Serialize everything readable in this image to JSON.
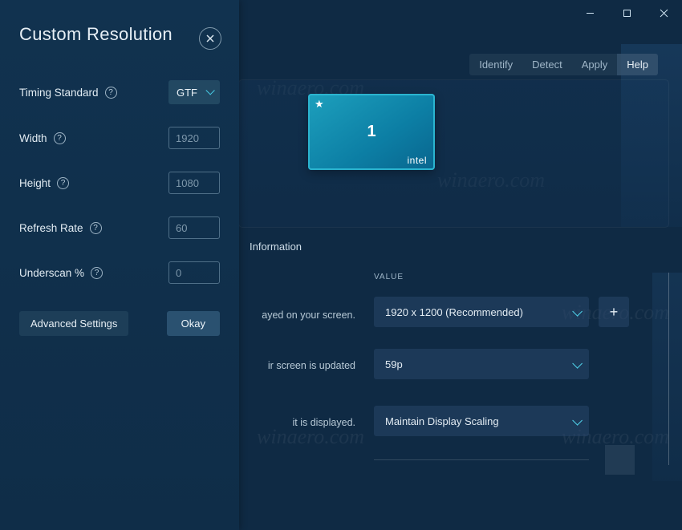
{
  "dialog": {
    "title": "Custom Resolution",
    "fields": {
      "timing_standard": {
        "label": "Timing Standard",
        "value": "GTF"
      },
      "width": {
        "label": "Width",
        "placeholder": "1920"
      },
      "height": {
        "label": "Height",
        "placeholder": "1080"
      },
      "refresh_rate": {
        "label": "Refresh Rate",
        "placeholder": "60"
      },
      "underscan": {
        "label": "Underscan %",
        "placeholder": "0"
      }
    },
    "advanced_btn": "Advanced Settings",
    "okay_btn": "Okay"
  },
  "actions": {
    "identify": "Identify",
    "detect": "Detect",
    "apply": "Apply",
    "help": "Help"
  },
  "monitor": {
    "number": "1",
    "brand": "intel",
    "star": "★"
  },
  "info": {
    "tab": "Information",
    "value_header": "VALUE",
    "rows": {
      "resolution": {
        "desc": "ayed on your screen.",
        "value": "1920 x 1200 (Recommended)"
      },
      "refresh": {
        "desc": "ir screen is updated",
        "value": "59p"
      },
      "scaling": {
        "desc": "it is displayed.",
        "value": "Maintain Display Scaling"
      }
    },
    "plus": "+"
  },
  "watermark": "winaero.com"
}
